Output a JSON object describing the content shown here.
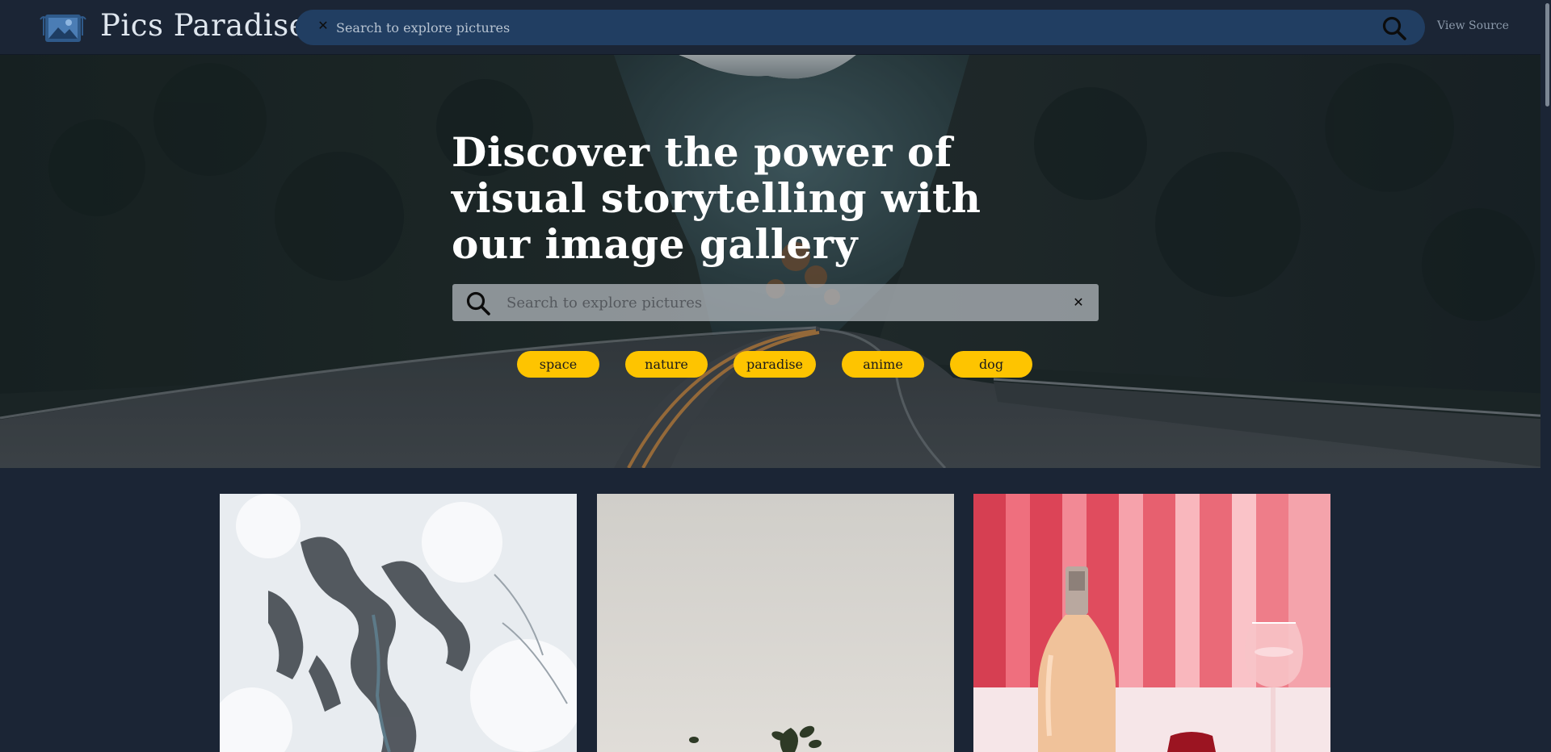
{
  "header": {
    "logo_icon": "photo-gallery-logo-icon",
    "brand": "Pics Paradise",
    "search": {
      "placeholder": "Search to explore pictures",
      "clear_icon": "close-icon",
      "submit_icon": "search-icon"
    },
    "view_source_label": "View Source"
  },
  "hero": {
    "title": "Discover the power of visual storytelling with our image gallery",
    "search": {
      "placeholder": "Search to explore pictures",
      "submit_icon": "search-icon",
      "clear_icon": "close-icon"
    },
    "tags": [
      {
        "label": "space"
      },
      {
        "label": "nature"
      },
      {
        "label": "paradise"
      },
      {
        "label": "anime"
      },
      {
        "label": "dog"
      }
    ],
    "background": "winding forest road photo"
  },
  "gallery": {
    "images": [
      {
        "subject": "snowy mountain aerial"
      },
      {
        "subject": "plant on neutral background"
      },
      {
        "subject": "rosé wine bottle and glass"
      }
    ]
  },
  "colors": {
    "page_bg": "#1b2535",
    "header_search_bg": "#213e62",
    "tag_bg": "#fec400",
    "hero_title": "#ffffff",
    "brand_text": "#dfe6ee",
    "view_source": "#8c9aab"
  }
}
